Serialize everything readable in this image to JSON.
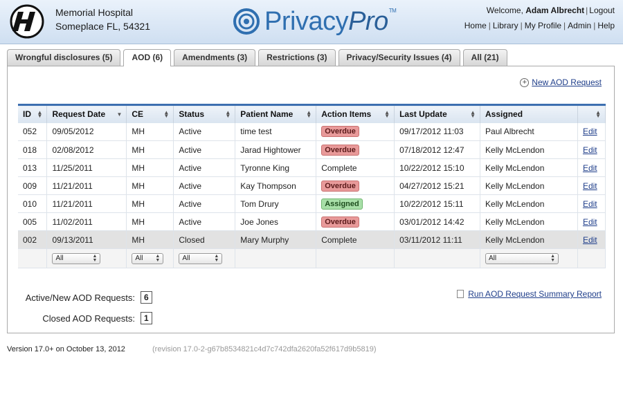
{
  "hospital": {
    "name": "Memorial Hospital",
    "location": "Someplace FL, 54321"
  },
  "brand": {
    "part1": "Privacy",
    "part2": "Pro",
    "tm": "TM"
  },
  "user": {
    "welcome": "Welcome,",
    "name": "Adam Albrecht",
    "logout": "Logout"
  },
  "nav": [
    "Home",
    "Library",
    "My Profile",
    "Admin",
    "Help"
  ],
  "tabs": [
    {
      "label": "Wrongful disclosures (5)"
    },
    {
      "label": "AOD (6)"
    },
    {
      "label": "Amendments (3)"
    },
    {
      "label": "Restrictions (3)"
    },
    {
      "label": "Privacy/Security Issues (4)"
    },
    {
      "label": "All (21)"
    }
  ],
  "new_request_label": "New AOD Request",
  "table": {
    "headers": [
      "ID",
      "Request Date",
      "CE",
      "Status",
      "Patient Name",
      "Action Items",
      "Last Update",
      "Assigned",
      ""
    ],
    "rows": [
      {
        "id": "052",
        "date": "09/05/2012",
        "ce": "MH",
        "status": "Active",
        "patient": "time test",
        "action": "Overdue",
        "update": "09/17/2012 11:03",
        "assigned": "Paul Albrecht",
        "edit": "Edit"
      },
      {
        "id": "018",
        "date": "02/08/2012",
        "ce": "MH",
        "status": "Active",
        "patient": "Jarad Hightower",
        "action": "Overdue",
        "update": "07/18/2012 12:47",
        "assigned": "Kelly McLendon",
        "edit": "Edit"
      },
      {
        "id": "013",
        "date": "11/25/2011",
        "ce": "MH",
        "status": "Active",
        "patient": "Tyronne King",
        "action": "Complete",
        "update": "10/22/2012 15:10",
        "assigned": "Kelly McLendon",
        "edit": "Edit"
      },
      {
        "id": "009",
        "date": "11/21/2011",
        "ce": "MH",
        "status": "Active",
        "patient": "Kay Thompson",
        "action": "Overdue",
        "update": "04/27/2012 15:21",
        "assigned": "Kelly McLendon",
        "edit": "Edit"
      },
      {
        "id": "010",
        "date": "11/21/2011",
        "ce": "MH",
        "status": "Active",
        "patient": "Tom Drury",
        "action": "Assigned",
        "update": "10/22/2012 15:11",
        "assigned": "Kelly McLendon",
        "edit": "Edit"
      },
      {
        "id": "005",
        "date": "11/02/2011",
        "ce": "MH",
        "status": "Active",
        "patient": "Joe Jones",
        "action": "Overdue",
        "update": "03/01/2012 14:42",
        "assigned": "Kelly McLendon",
        "edit": "Edit"
      },
      {
        "id": "002",
        "date": "09/13/2011",
        "ce": "MH",
        "status": "Closed",
        "patient": "Mary Murphy",
        "action": "Complete",
        "update": "03/11/2012 11:11",
        "assigned": "Kelly McLendon",
        "edit": "Edit"
      }
    ],
    "filters": {
      "request_date": "All",
      "ce": "All",
      "status": "All",
      "assigned": "All"
    }
  },
  "counts": {
    "active_label": "Active/New AOD Requests:",
    "active_value": "6",
    "closed_label": "Closed AOD Requests:",
    "closed_value": "1"
  },
  "report_label": "Run AOD Request Summary Report",
  "footer": {
    "version": "Version 17.0+ on October 13, 2012",
    "revision": "(revision 17.0-2-g67b8534821c4d7c742dfa2620fa52f617d9b5819)"
  },
  "colors": {
    "accent": "#3d6fb0",
    "overdue": "#e89a9a",
    "assigned": "#a8dfa8",
    "link": "#1f3e8a"
  },
  "icons": [
    "hospital-logo-icon",
    "privacypro-logo-icon",
    "plus-circle-icon",
    "sort-icon",
    "dropdown-arrow-icon",
    "document-icon"
  ]
}
